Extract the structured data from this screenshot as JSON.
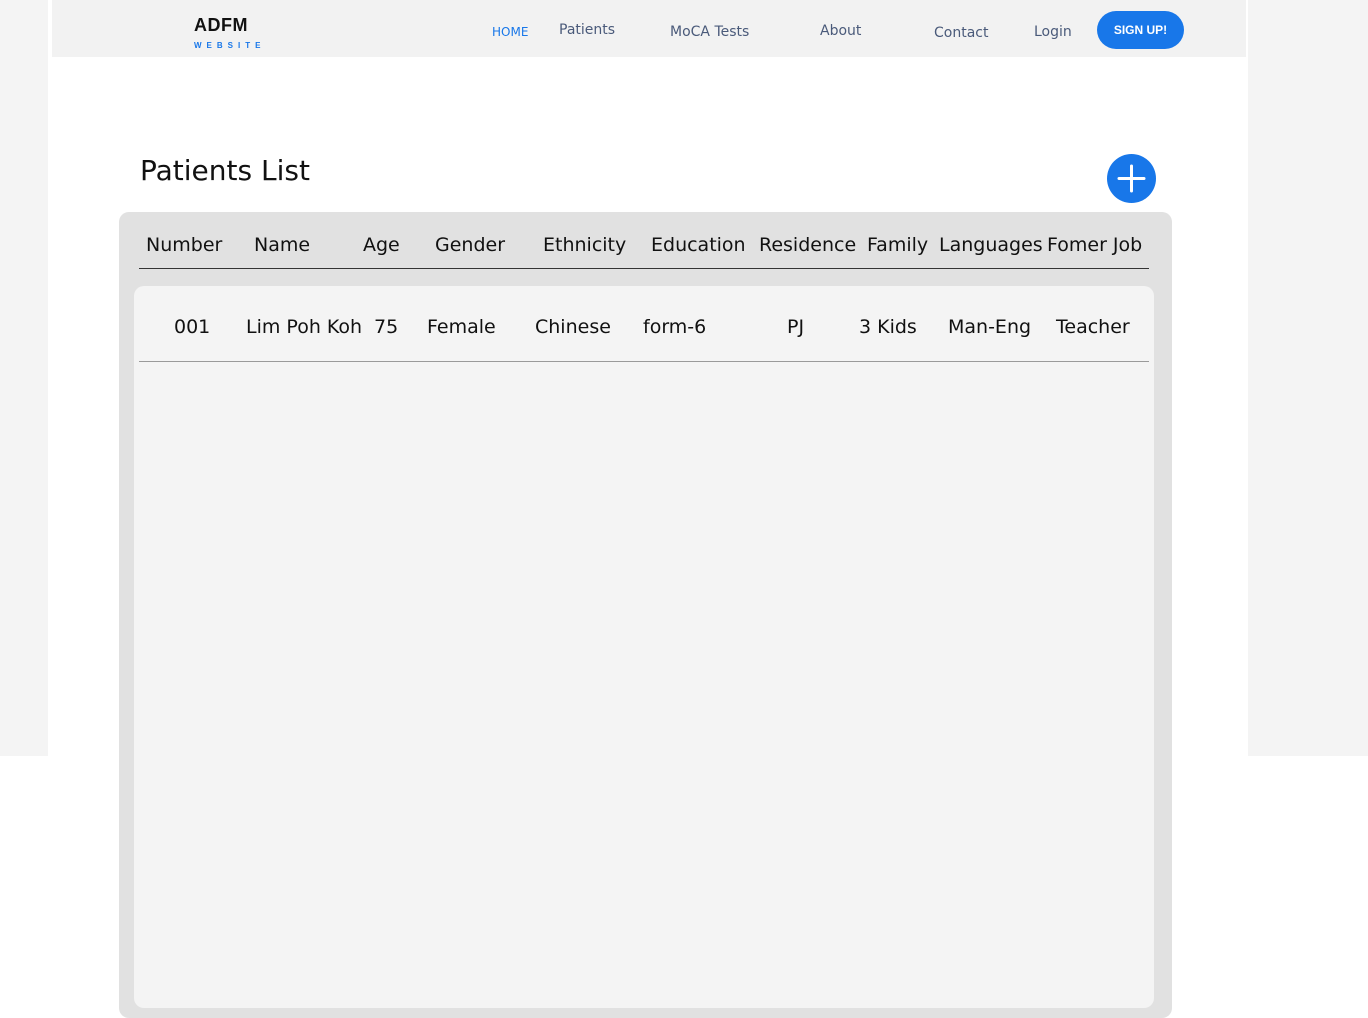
{
  "brand": {
    "title": "ADFM",
    "subtitle": "WEBSITE",
    "accent_color": "#1877e9"
  },
  "nav": {
    "home": "HOME",
    "patients": "Patients",
    "moca": "MoCA Tests",
    "about": "About",
    "contact": "Contact",
    "login": "Login",
    "signup": "SIGN UP!"
  },
  "page": {
    "title": "Patients List",
    "add_icon": "plus-icon"
  },
  "table": {
    "columns": [
      "Number",
      "Name",
      "Age",
      "Gender",
      "Ethnicity",
      "Education",
      "Residence",
      "Family",
      "Languages",
      "Fomer Job"
    ],
    "rows": [
      [
        "001",
        "Lim Poh Koh",
        "75",
        "Female",
        "Chinese",
        "form-6",
        "PJ",
        "3 Kids",
        "Man-Eng",
        "Teacher"
      ]
    ]
  }
}
